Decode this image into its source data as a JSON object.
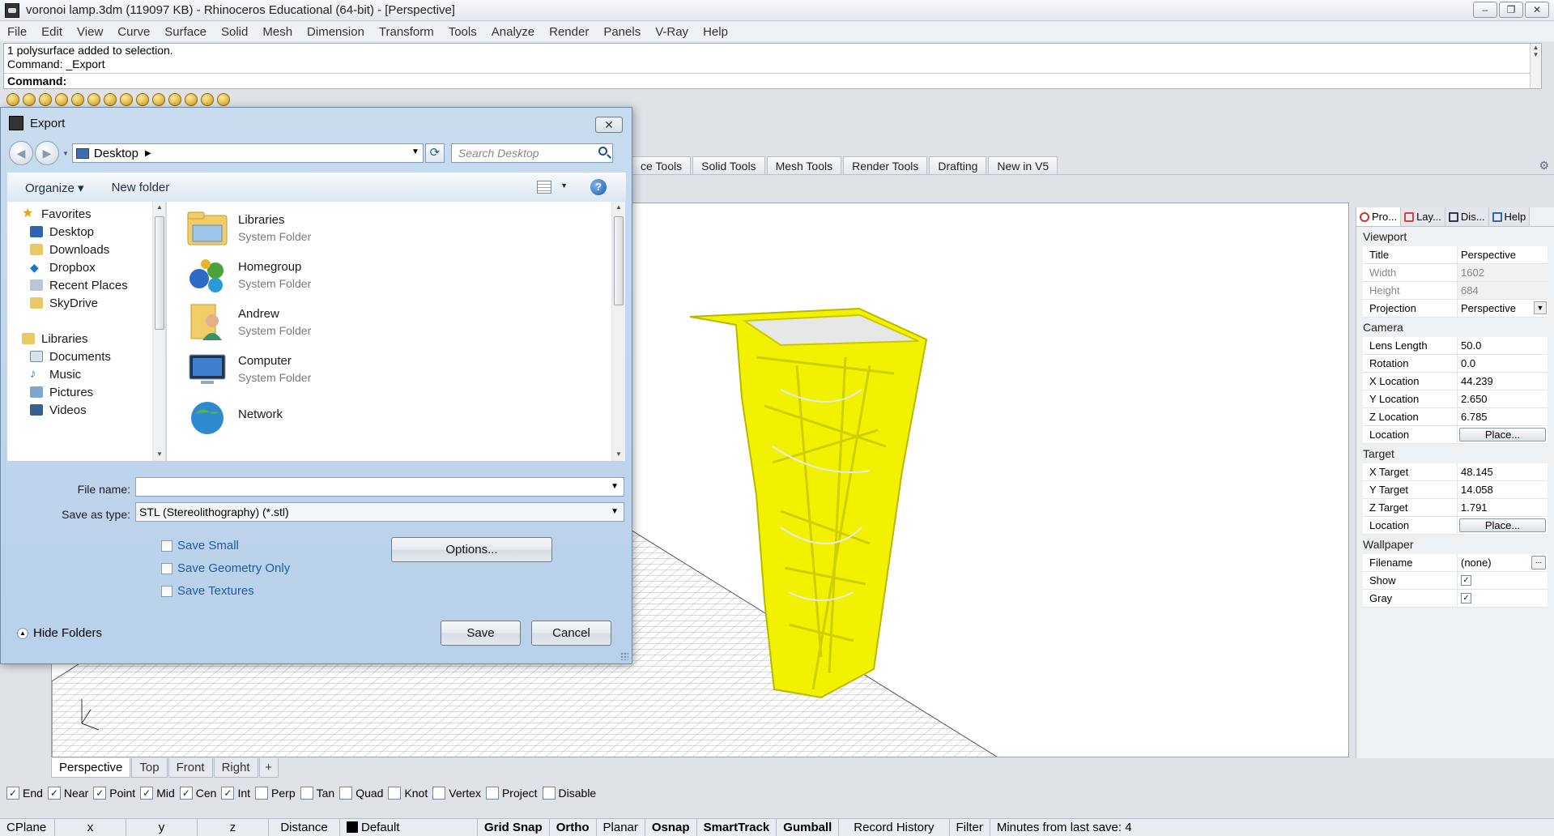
{
  "window": {
    "title": "voronoi lamp.3dm (119097 KB) - Rhinoceros Educational (64-bit) - [Perspective]",
    "buttons": [
      "–",
      "❐",
      "✕"
    ]
  },
  "menu": [
    "File",
    "Edit",
    "View",
    "Curve",
    "Surface",
    "Solid",
    "Mesh",
    "Dimension",
    "Transform",
    "Tools",
    "Analyze",
    "Render",
    "Panels",
    "V-Ray",
    "Help"
  ],
  "command": {
    "history": [
      "1 polysurface added to selection.",
      "Command: _Export"
    ],
    "prompt": "Command:"
  },
  "toolbar_tabs": [
    "ce Tools",
    "Solid Tools",
    "Mesh Tools",
    "Render Tools",
    "Drafting",
    "New in V5"
  ],
  "viewport_tabs": [
    "Perspective",
    "Top",
    "Front",
    "Right",
    "+"
  ],
  "osnaps": [
    {
      "label": "End",
      "checked": true
    },
    {
      "label": "Near",
      "checked": true
    },
    {
      "label": "Point",
      "checked": true
    },
    {
      "label": "Mid",
      "checked": true
    },
    {
      "label": "Cen",
      "checked": true
    },
    {
      "label": "Int",
      "checked": true
    },
    {
      "label": "Perp",
      "checked": false
    },
    {
      "label": "Tan",
      "checked": false
    },
    {
      "label": "Quad",
      "checked": false
    },
    {
      "label": "Knot",
      "checked": false
    },
    {
      "label": "Vertex",
      "checked": false
    },
    {
      "label": "Project",
      "checked": false
    },
    {
      "label": "Disable",
      "checked": false
    }
  ],
  "statusbar": {
    "cplane": "CPlane",
    "x": "x",
    "y": "y",
    "z": "z",
    "distance": "Distance",
    "layer": "Default",
    "grid_snap": "Grid Snap",
    "ortho": "Ortho",
    "planar": "Planar",
    "osnap": "Osnap",
    "smarttrack": "SmartTrack",
    "gumball": "Gumball",
    "record_history": "Record History",
    "filter": "Filter",
    "minutes": "Minutes from last save: 4"
  },
  "properties": {
    "tabs": [
      "Pro...",
      "Lay...",
      "Dis...",
      "Help"
    ],
    "viewport_header": "Viewport",
    "title_label": "Title",
    "title_value": "Perspective",
    "width_label": "Width",
    "width_value": "1602",
    "height_label": "Height",
    "height_value": "684",
    "projection_label": "Projection",
    "projection_value": "Perspective",
    "camera_header": "Camera",
    "lens_label": "Lens Length",
    "lens_value": "50.0",
    "rotation_label": "Rotation",
    "rotation_value": "0.0",
    "xloc_label": "X Location",
    "xloc_value": "44.239",
    "yloc_label": "Y Location",
    "yloc_value": "2.650",
    "zloc_label": "Z Location",
    "zloc_value": "6.785",
    "location_label": "Location",
    "place_button": "Place...",
    "target_header": "Target",
    "xt_label": "X Target",
    "xt_value": "48.145",
    "yt_label": "Y Target",
    "yt_value": "14.058",
    "zt_label": "Z Target",
    "zt_value": "1.791",
    "location2_label": "Location",
    "place2_button": "Place...",
    "wallpaper_header": "Wallpaper",
    "filename_label": "Filename",
    "filename_value": "(none)",
    "dots": "...",
    "show_label": "Show",
    "gray_label": "Gray"
  },
  "export_dialog": {
    "title": "Export",
    "close": "✕",
    "location": "Desktop",
    "search_placeholder": "Search Desktop",
    "organize": "Organize ▾",
    "new_folder": "New folder",
    "tree": {
      "favorites": "Favorites",
      "desktop": "Desktop",
      "downloads": "Downloads",
      "dropbox": "Dropbox",
      "recent": "Recent Places",
      "skydrive": "SkyDrive",
      "libraries": "Libraries",
      "documents": "Documents",
      "music": "Music",
      "pictures": "Pictures",
      "videos": "Videos"
    },
    "files": [
      {
        "name": "Libraries",
        "type": "System Folder"
      },
      {
        "name": "Homegroup",
        "type": "System Folder"
      },
      {
        "name": "Andrew",
        "type": "System Folder"
      },
      {
        "name": "Computer",
        "type": "System Folder"
      },
      {
        "name": "Network",
        "type": ""
      }
    ],
    "file_name_label": "File name:",
    "file_name_value": "",
    "save_type_label": "Save as type:",
    "save_type_value": "STL (Stereolithography) (*.stl)",
    "save_small": "Save Small",
    "save_geometry": "Save Geometry Only",
    "save_textures": "Save Textures",
    "options_button": "Options...",
    "save_button": "Save",
    "cancel_button": "Cancel",
    "hide_folders": "Hide Folders"
  },
  "colors": {
    "object_highlight": "#f2f200",
    "accent": "#1e5aa8"
  }
}
